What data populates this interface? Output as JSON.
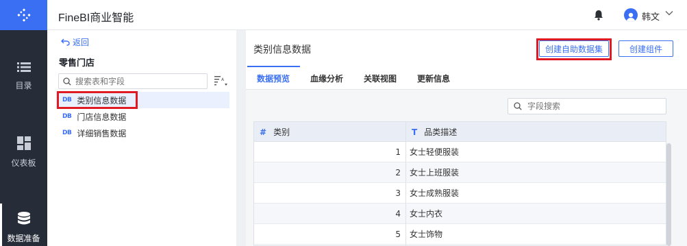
{
  "app": {
    "title": "FineBI商业智能"
  },
  "nav": {
    "items": [
      {
        "label": "目录",
        "icon": "catalog-list-icon"
      },
      {
        "label": "仪表板",
        "icon": "dashboard-grid-icon"
      },
      {
        "label": "数据准备",
        "icon": "database-icon"
      }
    ],
    "active": "数据准备"
  },
  "topbar": {
    "user_name": "韩文",
    "bell_icon": "bell-icon",
    "chevron_icon": "chevron-down-icon"
  },
  "tree": {
    "back_label": "返回",
    "package_title": "零售门店",
    "search_placeholder": "搜索表和字段",
    "db_badge": "DB",
    "items": [
      {
        "label": "类别信息数据",
        "selected": true
      },
      {
        "label": "门店信息数据",
        "selected": false
      },
      {
        "label": "详细销售数据",
        "selected": false
      }
    ]
  },
  "main": {
    "title": "类别信息数据",
    "create_self_dataset_label": "创建自助数据集",
    "create_component_label": "创建组件",
    "tabs": [
      "数据预览",
      "血缘分析",
      "关联视图",
      "更新信息"
    ],
    "active_tab": "数据预览",
    "field_search_placeholder": "字段搜索"
  },
  "table": {
    "columns": [
      {
        "type_icon": "#",
        "label": "类别"
      },
      {
        "type_icon": "T",
        "label": "品类描述"
      }
    ],
    "rows": [
      {
        "id": "1",
        "desc": "女士轻便服装"
      },
      {
        "id": "2",
        "desc": "女士上班服装"
      },
      {
        "id": "3",
        "desc": "女士成熟服装"
      },
      {
        "id": "4",
        "desc": "女士内衣"
      },
      {
        "id": "5",
        "desc": "女士饰物"
      }
    ]
  },
  "colors": {
    "accent": "#3a6ff3",
    "nav_bg": "#262d39",
    "highlight": "#e01a23"
  }
}
